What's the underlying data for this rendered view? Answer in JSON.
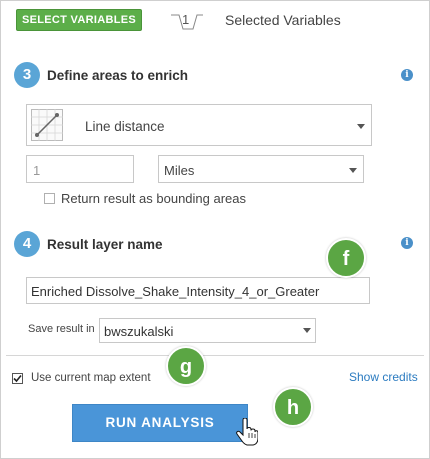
{
  "header": {
    "select_variables_label": "SELECT VARIABLES",
    "variable_count": "1",
    "selected_variables_label": "Selected Variables"
  },
  "step3": {
    "number": "3",
    "title": "Define areas to enrich",
    "area_type_value": "Line distance",
    "distance_value": "1",
    "units_value": "Miles",
    "bounding_label": "Return result as bounding areas",
    "bounding_checked": false
  },
  "step4": {
    "number": "4",
    "title": "Result layer name",
    "layer_name_value": "Enriched Dissolve_Shake_Intensity_4_or_Greater",
    "save_in_label": "Save result in",
    "save_in_value": "bwszukalski"
  },
  "footer": {
    "map_extent_label": "Use current map extent",
    "map_extent_checked": true,
    "show_credits_label": "Show credits",
    "run_label": "RUN ANALYSIS"
  },
  "callouts": {
    "f": "f",
    "g": "g",
    "h": "h"
  },
  "icons": {
    "info": "info-icon",
    "line_distance": "line-distance-icon",
    "cursor": "hand-cursor-icon"
  },
  "colors": {
    "select_button": "#5cae49",
    "step_circle": "#5aa5d6",
    "run_button": "#4a95d8",
    "callout": "#5ba644",
    "link": "#2b7bc0"
  }
}
